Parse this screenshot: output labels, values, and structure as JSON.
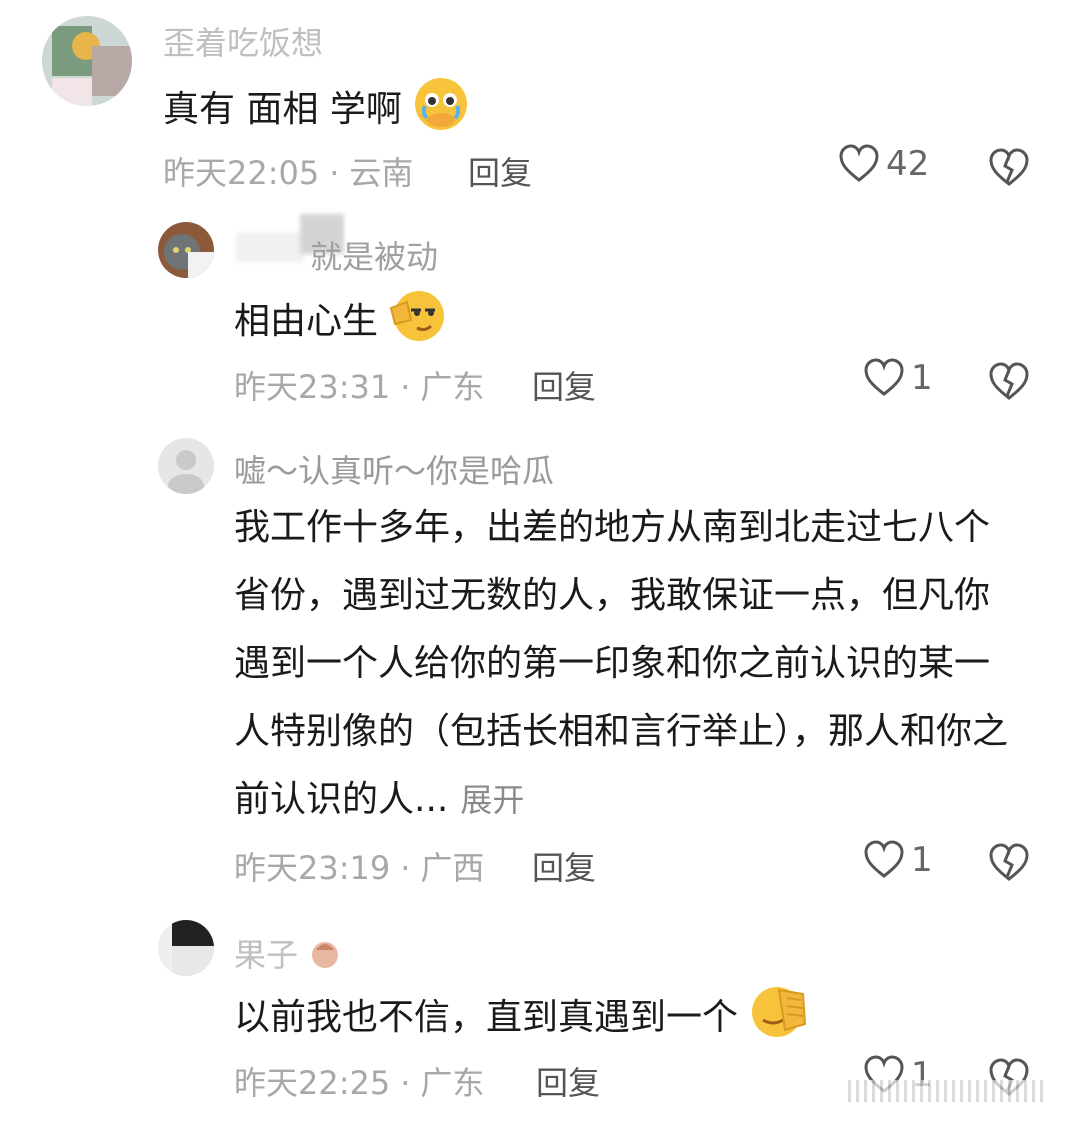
{
  "comments": [
    {
      "username": "歪着吃饭想",
      "text": "真有 面相 学啊",
      "emoji": "crying-face-emoji",
      "time": "昨天22:05",
      "location": "云南",
      "reply_label": "回复",
      "likes": "42"
    },
    {
      "username": "就是被动",
      "text": "相由心生",
      "emoji": "salute-face-emoji",
      "time": "昨天23:31",
      "location": "广东",
      "reply_label": "回复",
      "likes": "1"
    },
    {
      "username": "嘘～认真听～你是哈瓜",
      "text": "我工作十多年，出差的地方从南到北走过七八个省份，遇到过无数的人，我敢保证一点，但凡你遇到一个人给你的第一印象和你之前认识的某一人特别像的（包括长相和言行举止），那人和你之前认识的人...",
      "expand_label": "展开",
      "time": "昨天23:19",
      "location": "广西",
      "reply_label": "回复",
      "likes": "1"
    },
    {
      "username": "果子",
      "text": "以前我也不信，直到真遇到一个",
      "emoji": "face-palm-emoji",
      "time": "昨天22:25",
      "location": "广东",
      "reply_label": "回复",
      "likes": "1"
    }
  ],
  "colors": {
    "meta_gray": "#a8a8a8",
    "text_dark": "#1a1a1a",
    "emoji_yellow": "#f7c33a"
  }
}
